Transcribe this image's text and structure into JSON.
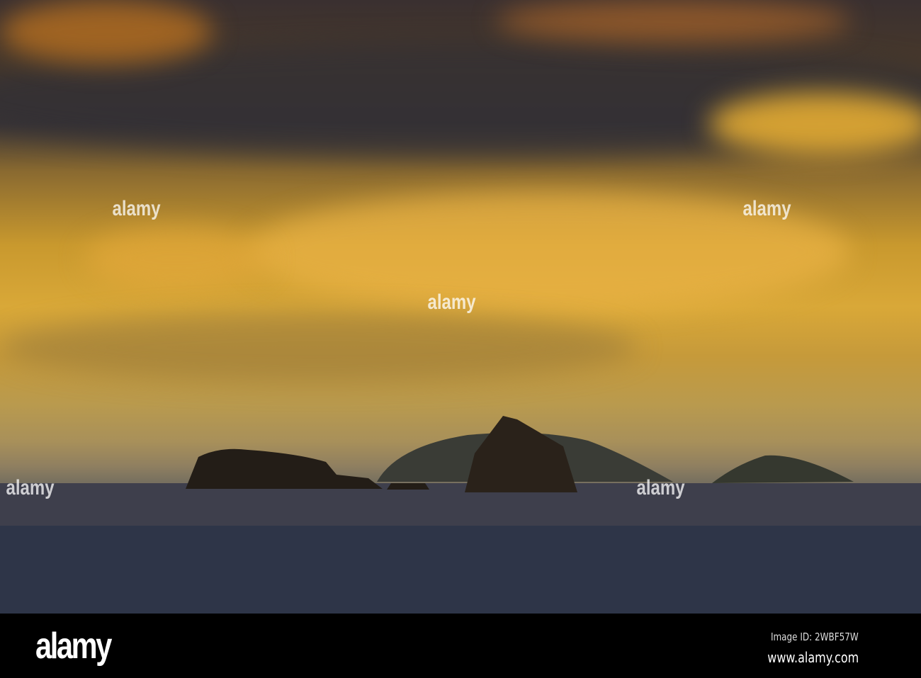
{
  "watermark": {
    "logo": "alamy",
    "image_id": "Image ID: 2WBF57W",
    "website": "www.alamy.com"
  }
}
